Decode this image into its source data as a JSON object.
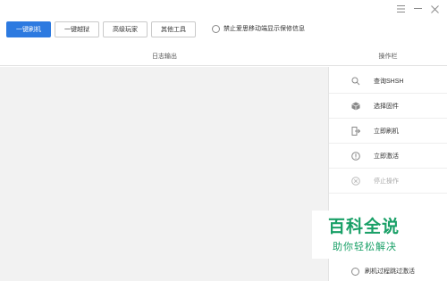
{
  "toolbar": {
    "buttons": [
      {
        "label": "一键刷机",
        "primary": true
      },
      {
        "label": "一键越狱",
        "primary": false
      },
      {
        "label": "高级玩家",
        "primary": false
      },
      {
        "label": "其他工具",
        "primary": false
      }
    ],
    "privacy_option": "禁止爱思移动端显示保修信息",
    "privacy_checked": false
  },
  "window_controls": {
    "menu_icon": "menu-icon",
    "minimize_icon": "minimize-icon",
    "close_icon": "close-icon"
  },
  "headers": {
    "log": "日志输出",
    "ops": "操作栏"
  },
  "operations": [
    {
      "label": "查询SHSH",
      "icon": "search-icon",
      "enabled": true
    },
    {
      "label": "选择固件",
      "icon": "cube-icon",
      "enabled": true
    },
    {
      "label": "立即刷机",
      "icon": "flash-icon",
      "enabled": true
    },
    {
      "label": "立即激活",
      "icon": "info-circle-icon",
      "enabled": true
    },
    {
      "label": "停止操作",
      "icon": "stop-icon",
      "enabled": false
    }
  ],
  "bottom_option": {
    "label": "刷机过程跳过激活",
    "checked": false
  },
  "watermark": {
    "title": "百科全说",
    "subtitle": "助你轻松解决"
  },
  "colors": {
    "accent": "#2d7ae0",
    "log_bg": "#f2f2f2",
    "watermark": "#19a067"
  }
}
